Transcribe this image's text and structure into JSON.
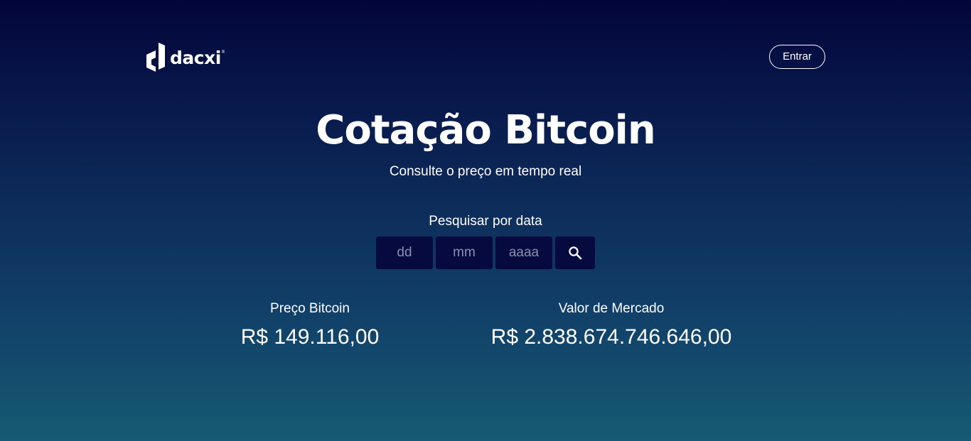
{
  "header": {
    "logo_text": "dacxi",
    "logo_reg": "®",
    "login_label": "Entrar"
  },
  "hero": {
    "title": "Cotação Bitcoin",
    "subtitle": "Consulte o preço em tempo real"
  },
  "search": {
    "label": "Pesquisar por data",
    "day_placeholder": "dd",
    "month_placeholder": "mm",
    "year_placeholder": "aaaa",
    "day_value": "",
    "month_value": "",
    "year_value": "",
    "button_icon": "search-icon"
  },
  "stats": {
    "price_label": "Preço Bitcoin",
    "price_value": "R$ 149.116,00",
    "market_label": "Valor de Mercado",
    "market_value": "R$ 2.838.674.746.646,00"
  },
  "colors": {
    "background_top": "#03053a",
    "background_bottom": "#165a72",
    "input_background": "#060a3e",
    "text": "#ffffff"
  }
}
